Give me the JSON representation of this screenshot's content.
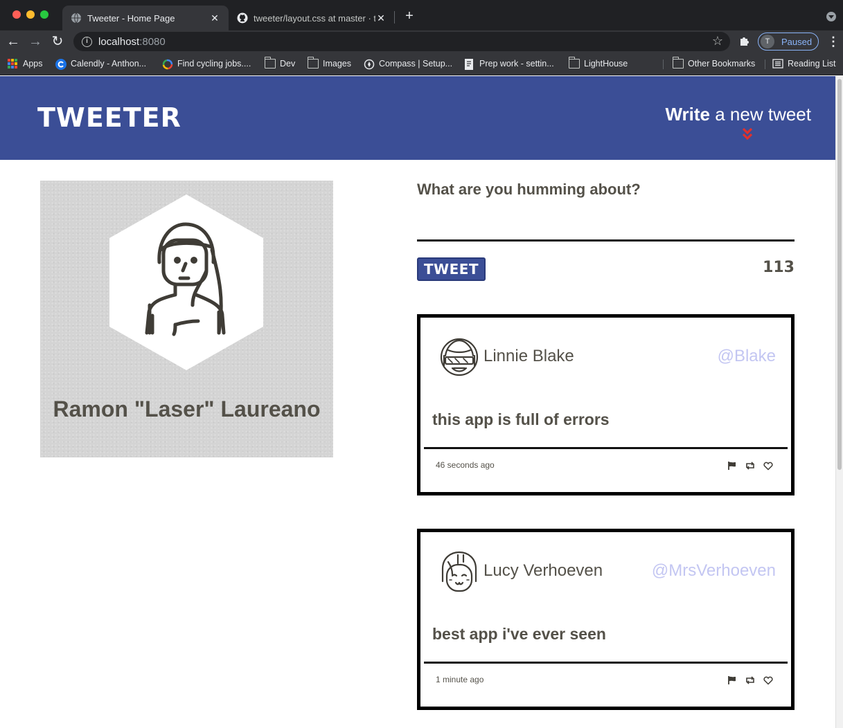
{
  "browser": {
    "tabs": [
      {
        "title": "Tweeter - Home Page",
        "active": true
      },
      {
        "title": "tweeter/layout.css at master · t",
        "active": false
      }
    ],
    "url_host": "localhost",
    "url_port": ":8080",
    "profile_initial": "T",
    "profile_status": "Paused",
    "bookmarks": [
      "Apps",
      "Calendly - Anthon...",
      "Find cycling jobs....",
      "Dev",
      "Images",
      "Compass | Setup...",
      "Prep work - settin...",
      "LightHouse",
      "Other Bookmarks",
      "Reading List"
    ]
  },
  "header": {
    "brand": "Tweeter",
    "compose_bold": "Write",
    "compose_rest": " a new tweet"
  },
  "profile": {
    "name": "Ramon \"Laser\" Laureano"
  },
  "composer": {
    "prompt": "What are you humming about?",
    "button_label": "Tweet",
    "counter": "113"
  },
  "tweets": [
    {
      "name": "Linnie Blake",
      "handle": "@Blake",
      "text": "this app is full of errors",
      "time": "46 seconds ago"
    },
    {
      "name": "Lucy Verhoeven",
      "handle": "@MrsVerhoeven",
      "text": "best app i've ever seen",
      "time": "1 minute ago"
    }
  ],
  "colors": {
    "navbar": "#3b4e96",
    "handle": "#c3c6f2",
    "text": "#545149",
    "arrow": "#e0312d"
  }
}
